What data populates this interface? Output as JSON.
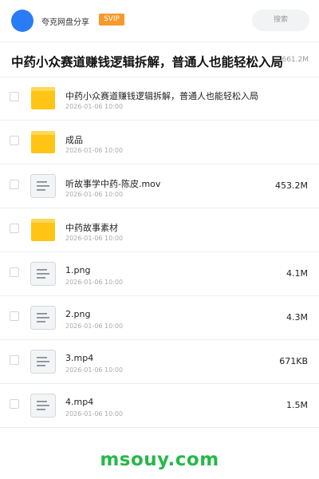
{
  "header": {
    "app_title": "夸克网盘分享",
    "badge": "SVIP",
    "search_placeholder": "搜索"
  },
  "page": {
    "title": "中药小众赛道赚钱逻辑拆解，普通人也能轻松入局",
    "total_size": "661.2M"
  },
  "files": [
    {
      "type": "folder",
      "name": "中药小众赛道赚钱逻辑拆解，普通人也能轻松入局",
      "date": "2026-01-06 10:00",
      "size": ""
    },
    {
      "type": "folder",
      "name": "成品",
      "date": "2026-01-06 10:00",
      "size": ""
    },
    {
      "type": "file",
      "name": "听故事学中药-陈皮.mov",
      "date": "2026-01-06 10:00",
      "size": "453.2M"
    },
    {
      "type": "folder",
      "name": "中药故事素材",
      "date": "2026-01-06 10:00",
      "size": ""
    },
    {
      "type": "file",
      "name": "1.png",
      "date": "2026-01-06 10:00",
      "size": "4.1M"
    },
    {
      "type": "file",
      "name": "2.png",
      "date": "2026-01-06 10:00",
      "size": "4.3M"
    },
    {
      "type": "file",
      "name": "3.mp4",
      "date": "2026-01-06 10:00",
      "size": "671KB"
    },
    {
      "type": "file",
      "name": "4.mp4",
      "date": "2026-01-06 10:00",
      "size": "1.5M"
    }
  ],
  "icons": {
    "folder": "folder-icon",
    "file": "document-icon"
  },
  "colors": {
    "accent": "#2a7cf6",
    "svip": "#f79a2c",
    "folder": "#ffc414",
    "watermark": "#26b84a"
  },
  "watermark": "msouy.com"
}
